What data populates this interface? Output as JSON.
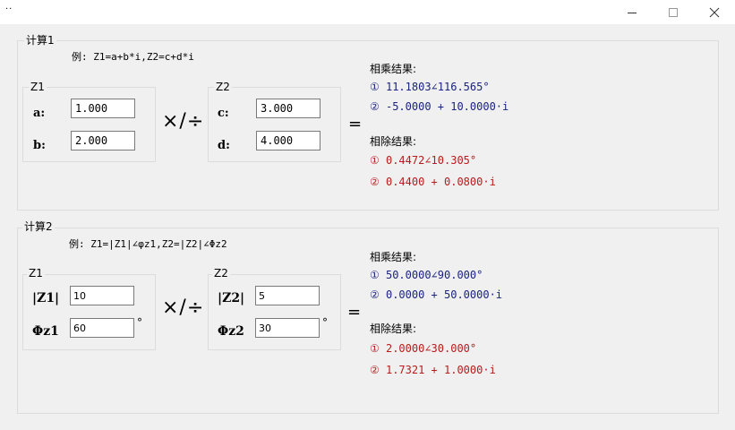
{
  "window": {
    "title": "..",
    "minimize_icon": "minimize-icon",
    "maximize_icon": "maximize-icon",
    "close_icon": "close-icon"
  },
  "calc1": {
    "group_title": "计算1",
    "example": "例: Z1=a+b*i,Z2=c+d*i",
    "z1_title": "Z1",
    "z2_title": "Z2",
    "a_label": "a:",
    "b_label": "b:",
    "c_label": "c:",
    "d_label": "d:",
    "a_value": "1.000",
    "b_value": "2.000",
    "c_value": "3.000",
    "d_value": "4.000",
    "operator": "×/÷",
    "equals": "=",
    "mul_title": "相乘结果:",
    "mul_r1": "① 11.1803∠116.565°",
    "mul_r2": "② -5.0000 + 10.0000·i",
    "div_title": "相除结果:",
    "div_r1": "① 0.4472∠10.305°",
    "div_r2": "② 0.4400 + 0.0800·i"
  },
  "calc2": {
    "group_title": "计算2",
    "example": "例: Z1=|Z1|∠φz1,Z2=|Z2|∠Φz2",
    "z1_title": "Z1",
    "z2_title": "Z2",
    "z1_mag_label": "|Z1|",
    "z1_phase_label": "Φz1",
    "z2_mag_label": "|Z2|",
    "z2_phase_label": "Φz2",
    "z1_mag_value": "10",
    "z1_phase_value": "60",
    "z2_mag_value": "5",
    "z2_phase_value": "30",
    "degree": "°",
    "operator": "×/÷",
    "equals": "=",
    "mul_title": "相乘结果:",
    "mul_r1": "① 50.0000∠90.000°",
    "mul_r2": "② 0.0000 + 50.0000·i",
    "div_title": "相除结果:",
    "div_r1": "① 2.0000∠30.000°",
    "div_r2": "② 1.7321 + 1.0000·i"
  },
  "colors": {
    "multiply_result": "#1a237e",
    "divide_result": "#b71c1c"
  }
}
